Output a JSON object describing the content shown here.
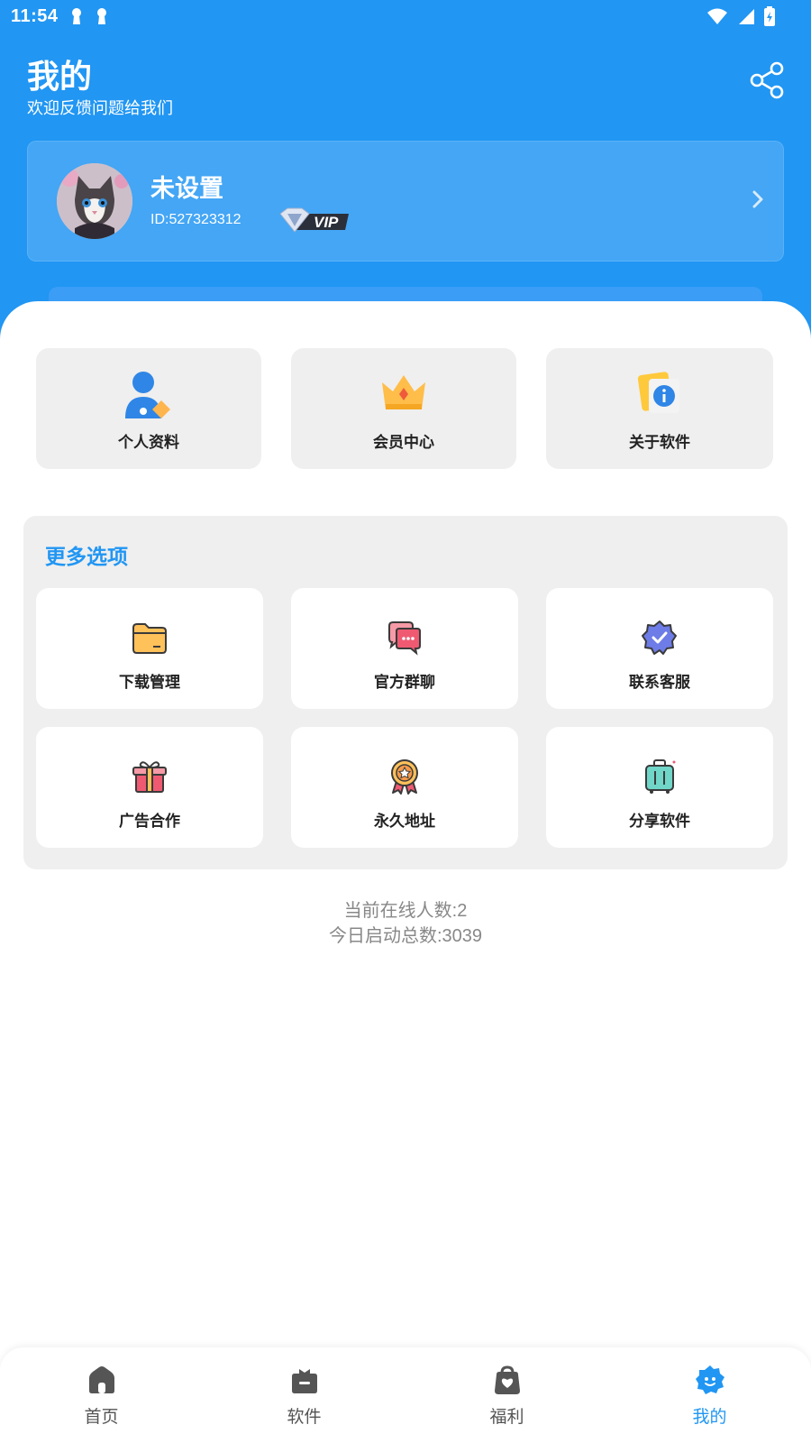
{
  "status_bar": {
    "time": "11:54"
  },
  "header": {
    "title": "我的",
    "subtitle": "欢迎反馈问题给我们"
  },
  "profile": {
    "name": "未设置",
    "id_text": "ID:527323312",
    "badge": "VIP"
  },
  "quick_tiles": [
    {
      "label": "个人资料",
      "icon": "user-profile-icon"
    },
    {
      "label": "会员中心",
      "icon": "crown-icon"
    },
    {
      "label": "关于软件",
      "icon": "info-icon"
    }
  ],
  "more_options": {
    "title": "更多选项",
    "items": [
      {
        "label": "下载管理",
        "icon": "folder-icon"
      },
      {
        "label": "官方群聊",
        "icon": "chat-icon"
      },
      {
        "label": "联系客服",
        "icon": "verified-badge-icon"
      },
      {
        "label": "广告合作",
        "icon": "gift-icon"
      },
      {
        "label": "永久地址",
        "icon": "medal-icon"
      },
      {
        "label": "分享软件",
        "icon": "luggage-icon"
      }
    ]
  },
  "stats": {
    "online": "当前在线人数:2",
    "launches": "今日启动总数:3039"
  },
  "bottom_nav": [
    {
      "label": "首页",
      "icon": "home-icon"
    },
    {
      "label": "软件",
      "icon": "apps-icon"
    },
    {
      "label": "福利",
      "icon": "bag-icon"
    },
    {
      "label": "我的",
      "icon": "profile-icon",
      "active": true
    }
  ],
  "colors": {
    "primary": "#2196F3",
    "tile_bg": "#EFEFEF",
    "text_muted": "#888888"
  }
}
